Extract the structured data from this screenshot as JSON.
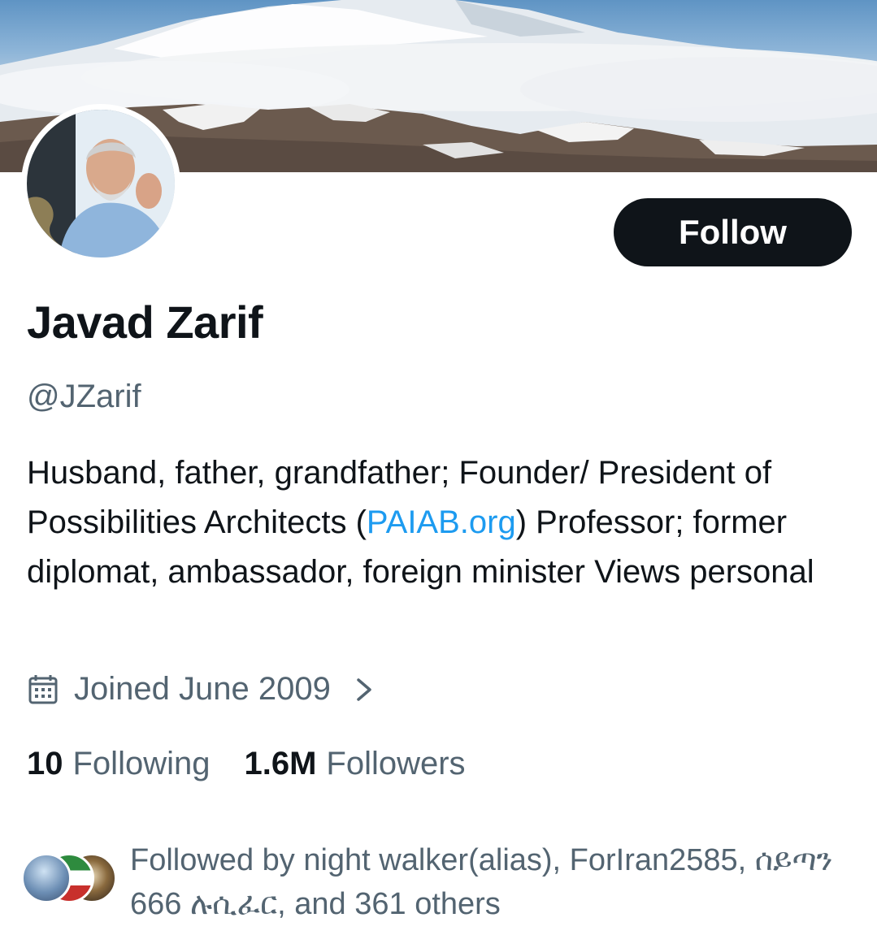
{
  "profile": {
    "display_name": "Javad Zarif",
    "handle": "@JZarif",
    "bio_part1": "Husband, father, grandfather;  Founder/ President of Possibilities Architects (",
    "bio_link": "PAIAB.org",
    "bio_part2": ") Professor; former diplomat, ambassador, foreign minister Views personal",
    "joined": "Joined June 2009"
  },
  "actions": {
    "follow_label": "Follow"
  },
  "stats": {
    "following_count": "10",
    "following_label": "Following",
    "followers_count": "1.6M",
    "followers_label": "Followers"
  },
  "followed_by": {
    "text": "Followed by night walker(alias), ForIran2585, ሰይጣን 666 ሉሲፈር, and 361 others"
  },
  "icons": {
    "joined": "calendar-icon",
    "joined_more": "chevron-right-icon"
  },
  "colors": {
    "primary_text": "#0f1419",
    "secondary_text": "#536471",
    "link": "#1d9bf0",
    "button_bg": "#0f1419"
  }
}
